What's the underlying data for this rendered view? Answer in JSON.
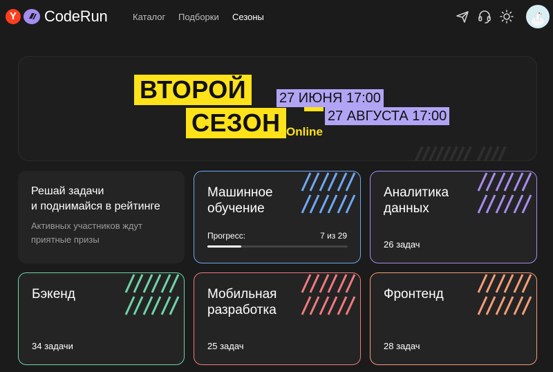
{
  "header": {
    "logo_letter": "Y",
    "logo_text": "CodeRun",
    "nav": [
      "Каталог",
      "Подборки",
      "Сезоны"
    ],
    "active_nav": "Сезоны",
    "icons": [
      "send-icon",
      "headset-icon",
      "sun-icon",
      "avatar"
    ]
  },
  "banner": {
    "title_line1": "ВТОРОЙ",
    "title_line2": "СЕЗОН",
    "date_start": "27 ИЮНЯ 17:00",
    "date_end": "27 АВГУСТА 17:00",
    "format": "Online",
    "colors": {
      "yellow": "#ffe21a",
      "lavender": "#b1a4f4"
    }
  },
  "intro": {
    "title_line1": "Решай задачи",
    "title_line2": "и поднимайся в рейтинге",
    "desc_line1": "Активных участников ждут",
    "desc_line2": "приятные призы"
  },
  "cards": [
    {
      "title_line1": "Машинное",
      "title_line2": "обучение",
      "progress_label": "Прогресс:",
      "progress_text": "7 из 29",
      "progress": 0.24,
      "accent": "#6fa8f5"
    },
    {
      "title_line1": "Аналитика",
      "title_line2": "данных",
      "count": "26 задач",
      "accent": "#a98cf0"
    },
    {
      "title_line1": "Бэкенд",
      "count": "34 задачи",
      "accent": "#6fd4a8"
    },
    {
      "title_line1": "Мобильная",
      "title_line2": "разработка",
      "count": "25 задач",
      "accent": "#f07a7e"
    },
    {
      "title_line1": "Фронтенд",
      "count": "28 задач",
      "accent": "#f59d78"
    }
  ]
}
